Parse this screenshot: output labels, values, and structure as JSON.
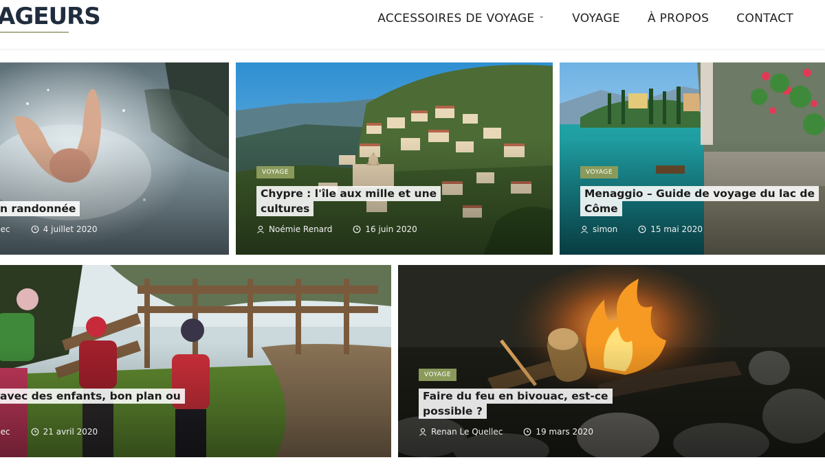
{
  "header": {
    "logo_text": "AGEURS",
    "nav": [
      {
        "label": "ACCESSOIRES DE VOYAGE",
        "dropdown": true
      },
      {
        "label": "VOYAGE",
        "dropdown": false
      },
      {
        "label": "À PROPOS",
        "dropdown": false
      },
      {
        "label": "CONTACT",
        "dropdown": false
      }
    ]
  },
  "posts": [
    {
      "category": "",
      "title_lines": [
        "n randonnée"
      ],
      "author": "llec",
      "date": "4 juillet 2020",
      "image_theme": "waterfall"
    },
    {
      "category": "VOYAGE",
      "title_lines": [
        "Chypre : l'île aux mille et une",
        "cultures"
      ],
      "author": "Noémie Renard",
      "date": "16 juin 2020",
      "image_theme": "hillside-village"
    },
    {
      "category": "VOYAGE",
      "title_lines": [
        "Menaggio – Guide de voyage du lac de",
        "Côme"
      ],
      "author": "simon",
      "date": "15 mai 2020",
      "image_theme": "lake-como"
    },
    {
      "category": "",
      "title_lines": [
        "avec des enfants, bon plan ou"
      ],
      "author": "llec",
      "date": "21 avril 2020",
      "image_theme": "kids-hiking"
    },
    {
      "category": "VOYAGE",
      "title_lines": [
        "Faire du feu en bivouac, est-ce",
        "possible ?"
      ],
      "author": "Renan Le Quellec",
      "date": "19 mars 2020",
      "image_theme": "campfire"
    }
  ],
  "colors": {
    "accent": "#8a9a5b",
    "logo": "#1f2d3d"
  }
}
